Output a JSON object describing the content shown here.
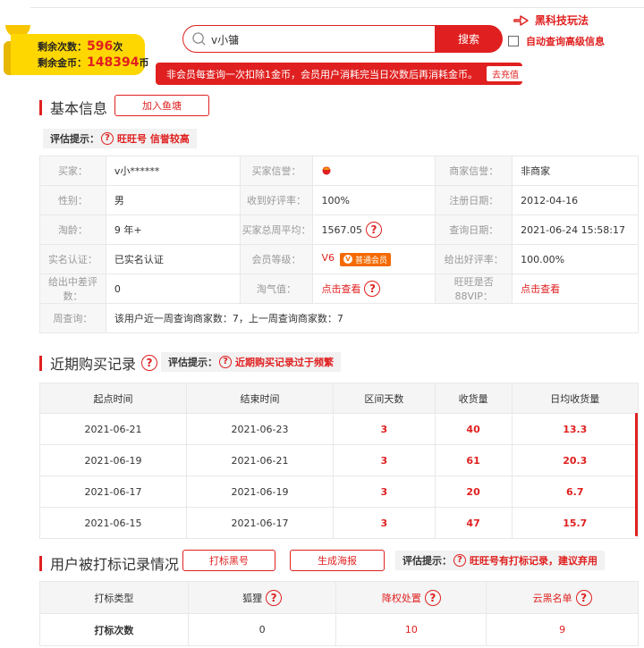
{
  "banner": {
    "remaining_times_label": "剩余次数：",
    "remaining_times": "596",
    "remaining_times_unit": "次",
    "remaining_coins_label": "剩余金币：",
    "remaining_coins": "148394",
    "remaining_coins_unit": "币"
  },
  "search": {
    "value": "v小镛",
    "button": "搜索"
  },
  "top_links": {
    "tech": "黑科技玩法",
    "auto_query": "自动查询高级信息"
  },
  "notice": {
    "text": "非会员每查询一次扣除1金币，会员用户消耗完当日次数后再消耗金币。",
    "recharge": "去充值"
  },
  "basic": {
    "title": "基本信息",
    "add_btn": "加入鱼塘",
    "hint_label": "评估提示：",
    "hint_value": "旺旺号 信誉较高",
    "rows": [
      [
        "买家",
        "v小******",
        "买家信誉",
        "",
        "商家信誉",
        "非商家"
      ],
      [
        "性别",
        "男",
        "收到好评率",
        "100%",
        "注册日期",
        "2012-04-16"
      ],
      [
        "淘龄",
        "9 年+",
        "买家总周平均",
        "1567.05",
        "查询日期",
        "2021-06-24 15:58:17"
      ],
      [
        "实名认证",
        "已实名认证",
        "会员等级",
        "V6",
        "给出好评率",
        "100.00%"
      ],
      [
        "给出中差评数",
        "0",
        "淘气值",
        "点击查看",
        "旺旺是否88VIP",
        "点击查看"
      ]
    ],
    "label_suffix": "：",
    "member_badge": "普通会员",
    "weekly_label": "周查询",
    "weekly_value": "该用户近一周查询商家数：7，上一周查询商家数：7"
  },
  "purchase": {
    "title": "近期购买记录",
    "hint_label": "评估提示：",
    "hint_value": "近期购买记录过于频繁",
    "headers": [
      "起点时间",
      "结束时间",
      "区间天数",
      "收货量",
      "日均收货量"
    ],
    "rows": [
      [
        "2021-06-21",
        "2021-06-23",
        "3",
        "40",
        "13.3"
      ],
      [
        "2021-06-19",
        "2021-06-21",
        "3",
        "61",
        "20.3"
      ],
      [
        "2021-06-17",
        "2021-06-19",
        "3",
        "20",
        "6.7"
      ],
      [
        "2021-06-15",
        "2021-06-17",
        "3",
        "47",
        "15.7"
      ]
    ]
  },
  "tagging": {
    "title": "用户被打标记录情况",
    "btn_mark": "打标黑号",
    "btn_poster": "生成海报",
    "hint_label": "评估提示：",
    "hint_value": "旺旺号有打标记录，建议弃用",
    "headers": [
      "打标类型",
      "狐狸",
      "降权处置",
      "云黑名单"
    ],
    "row_label": "打标次数",
    "values": [
      "0",
      "10",
      "9"
    ]
  },
  "colors": {
    "accent": "#e02020",
    "banner": "#ffd700"
  }
}
